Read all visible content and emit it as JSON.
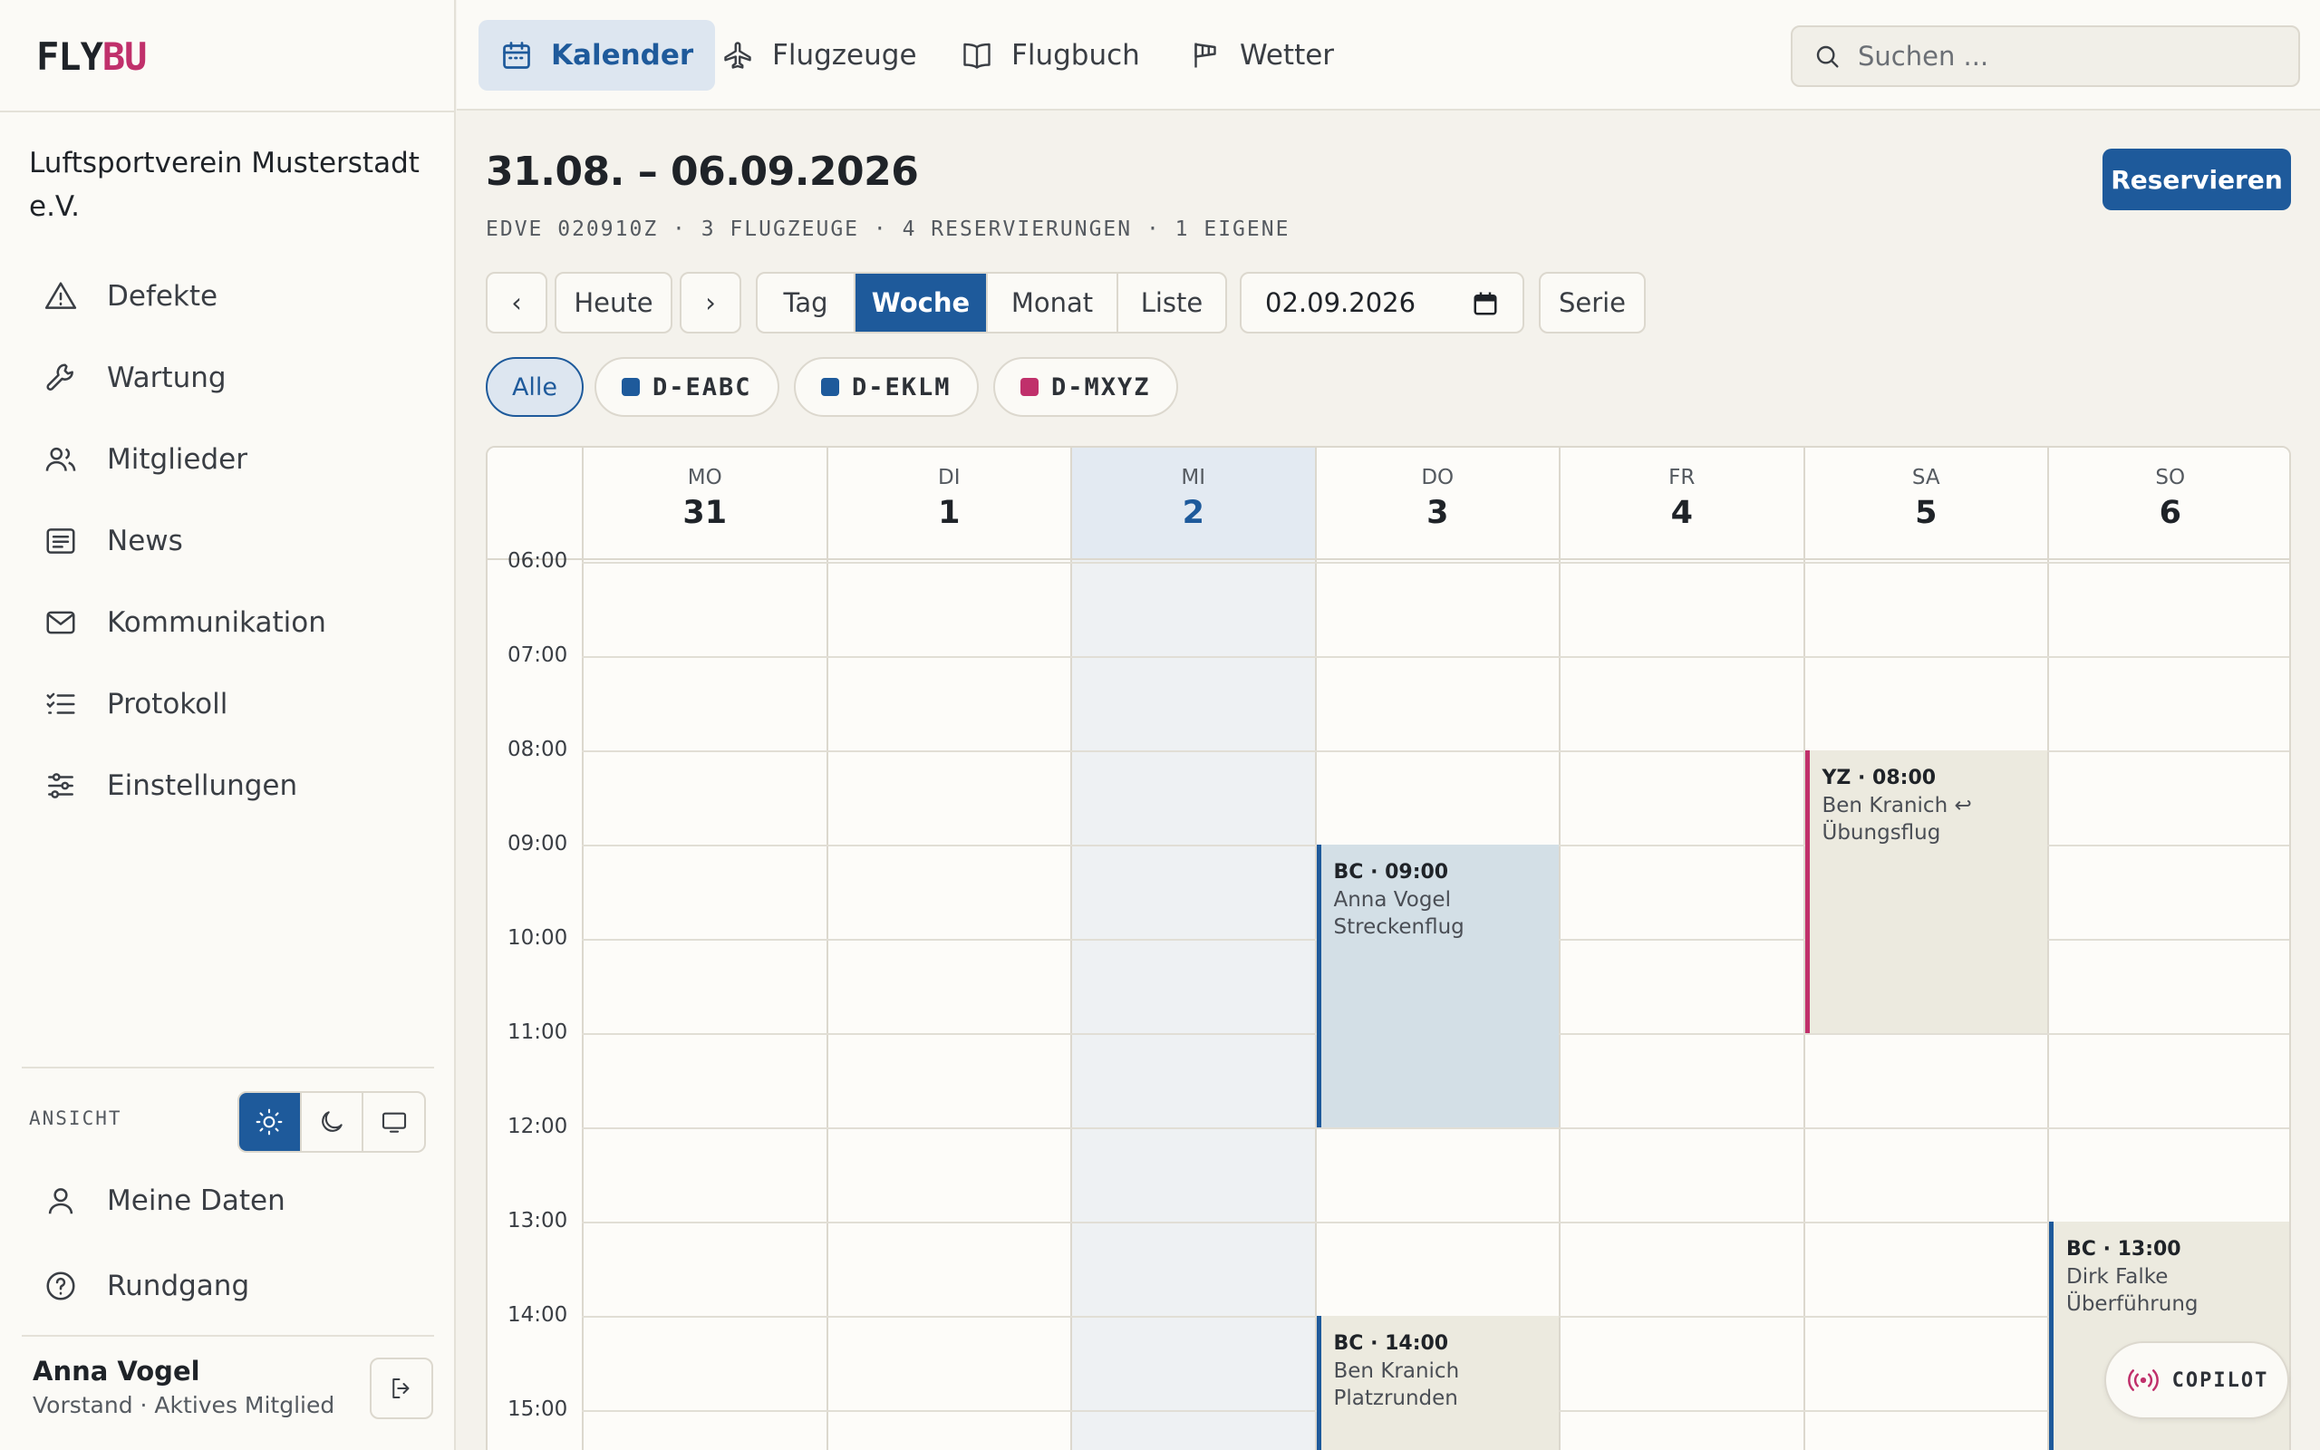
{
  "app": {
    "logo_fly": "FLY",
    "logo_bu": "BU",
    "org_name": "Luftsportverein Musterstadt e.V."
  },
  "nav": {
    "tabs": [
      {
        "label": "Kalender",
        "icon": "calendar-icon",
        "active": true
      },
      {
        "label": "Flugzeuge",
        "icon": "plane-icon"
      },
      {
        "label": "Flugbuch",
        "icon": "book-icon"
      },
      {
        "label": "Wetter",
        "icon": "windsock-icon"
      }
    ],
    "search_placeholder": "Suchen ..."
  },
  "sidebar": {
    "items": [
      {
        "label": "Defekte",
        "icon": "warning-icon"
      },
      {
        "label": "Wartung",
        "icon": "wrench-icon"
      },
      {
        "label": "Mitglieder",
        "icon": "users-icon"
      },
      {
        "label": "News",
        "icon": "news-icon"
      },
      {
        "label": "Kommunikation",
        "icon": "mail-icon"
      },
      {
        "label": "Protokoll",
        "icon": "list-icon"
      },
      {
        "label": "Einstellungen",
        "icon": "sliders-icon"
      }
    ],
    "ansicht_label": "ANSICHT",
    "theme_active": "light",
    "bottom": [
      {
        "label": "Meine Daten",
        "icon": "user-icon"
      },
      {
        "label": "Rundgang",
        "icon": "help-icon"
      }
    ],
    "user": {
      "name": "Anna Vogel",
      "role": "Vorstand · Aktives Mitglied"
    }
  },
  "header": {
    "range": "31.08. – 06.09.2026",
    "meta": "EDVE 020910Z · 3 FLUGZEUGE · 4 RESERVIERUNGEN · 1 EIGENE",
    "reserve_label": "Reservieren"
  },
  "controls": {
    "prev": "‹",
    "today": "Heute",
    "next": "›",
    "views": [
      "Tag",
      "Woche",
      "Monat",
      "Liste"
    ],
    "active_view": "Woche",
    "date": "02.09.2026",
    "serie": "Serie"
  },
  "filters": [
    {
      "label": "Alle",
      "active": true
    },
    {
      "label": "D-EABC",
      "color": "#1e5a9b"
    },
    {
      "label": "D-EKLM",
      "color": "#1e5a9b"
    },
    {
      "label": "D-MXYZ",
      "color": "#c0306b"
    }
  ],
  "calendar": {
    "days": [
      {
        "name": "MO",
        "date": "31"
      },
      {
        "name": "DI",
        "date": "1"
      },
      {
        "name": "MI",
        "date": "2",
        "today": true
      },
      {
        "name": "DO",
        "date": "3"
      },
      {
        "name": "FR",
        "date": "4"
      },
      {
        "name": "SA",
        "date": "5"
      },
      {
        "name": "SO",
        "date": "6"
      }
    ],
    "hours": [
      "06:00",
      "07:00",
      "08:00",
      "09:00",
      "10:00",
      "11:00",
      "12:00",
      "13:00",
      "14:00",
      "15:00"
    ],
    "events": [
      {
        "day": 3,
        "start": 9,
        "end": 12,
        "head": "BC · 09:00",
        "person": "Anna Vogel",
        "purpose": "Streckenflug",
        "style": "blue"
      },
      {
        "day": 5,
        "start": 8,
        "end": 11,
        "head": "YZ · 08:00",
        "person": "Ben Kranich ↩",
        "purpose": "Übungsflug",
        "style": "pink"
      },
      {
        "day": 6,
        "start": 13,
        "end": 16,
        "head": "BC · 13:00",
        "person": "Dirk Falke",
        "purpose": "Überführung",
        "style": "plain"
      },
      {
        "day": 3,
        "start": 14,
        "end": 16,
        "head": "BC · 14:00",
        "person": "Ben Kranich",
        "purpose": "Platzrunden",
        "style": "plain"
      }
    ]
  },
  "copilot_label": "COPILOT",
  "colors": {
    "accent": "#1e5a9b",
    "brand_pink": "#c0306b"
  }
}
